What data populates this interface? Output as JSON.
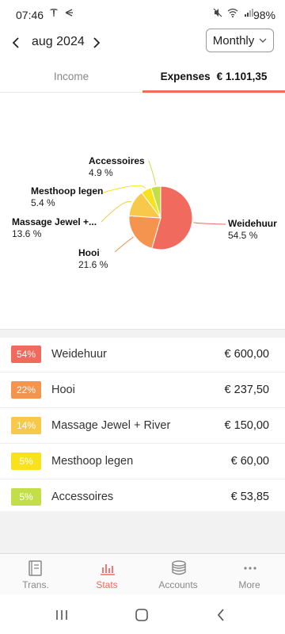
{
  "status_bar": {
    "time": "07:46",
    "battery": "98%"
  },
  "header": {
    "month": "aug 2024",
    "period": "Monthly"
  },
  "tabs": {
    "income": "Income",
    "expenses": "Expenses",
    "expenses_total": "€ 1.101,35"
  },
  "chart_data": {
    "type": "pie",
    "slices": [
      {
        "label": "Weidehuur",
        "percent_label": "54.5 %",
        "value": 54.5,
        "color": "#f06a5e"
      },
      {
        "label": "Hooi",
        "percent_label": "21.6 %",
        "value": 21.6,
        "color": "#f5944f"
      },
      {
        "label": "Massage Jewel +...",
        "percent_label": "13.6 %",
        "value": 13.6,
        "color": "#f7c84a"
      },
      {
        "label": "Mesthoop legen",
        "percent_label": "5.4 %",
        "value": 5.4,
        "color": "#f7e21d"
      },
      {
        "label": "Accessoires",
        "percent_label": "4.9 %",
        "value": 4.9,
        "color": "#c2df4a"
      }
    ]
  },
  "list": [
    {
      "badge": "54%",
      "label": "Weidehuur",
      "amount": "€ 600,00",
      "color": "#f06a5e"
    },
    {
      "badge": "22%",
      "label": "Hooi",
      "amount": "€ 237,50",
      "color": "#f5944f"
    },
    {
      "badge": "14%",
      "label": "Massage Jewel + River",
      "amount": "€ 150,00",
      "color": "#f7c84a"
    },
    {
      "badge": "5%",
      "label": "Mesthoop legen",
      "amount": "€ 60,00",
      "color": "#f7e21d"
    },
    {
      "badge": "5%",
      "label": "Accessoires",
      "amount": "€ 53,85",
      "color": "#c2df4a"
    }
  ],
  "bottom_nav": [
    {
      "label": "Trans.",
      "icon": "book-icon",
      "active": false
    },
    {
      "label": "Stats",
      "icon": "bar-chart-icon",
      "active": true
    },
    {
      "label": "Accounts",
      "icon": "coins-icon",
      "active": false
    },
    {
      "label": "More",
      "icon": "more-dots-icon",
      "active": false
    }
  ],
  "colors": {
    "accent": "#f06a5e"
  }
}
